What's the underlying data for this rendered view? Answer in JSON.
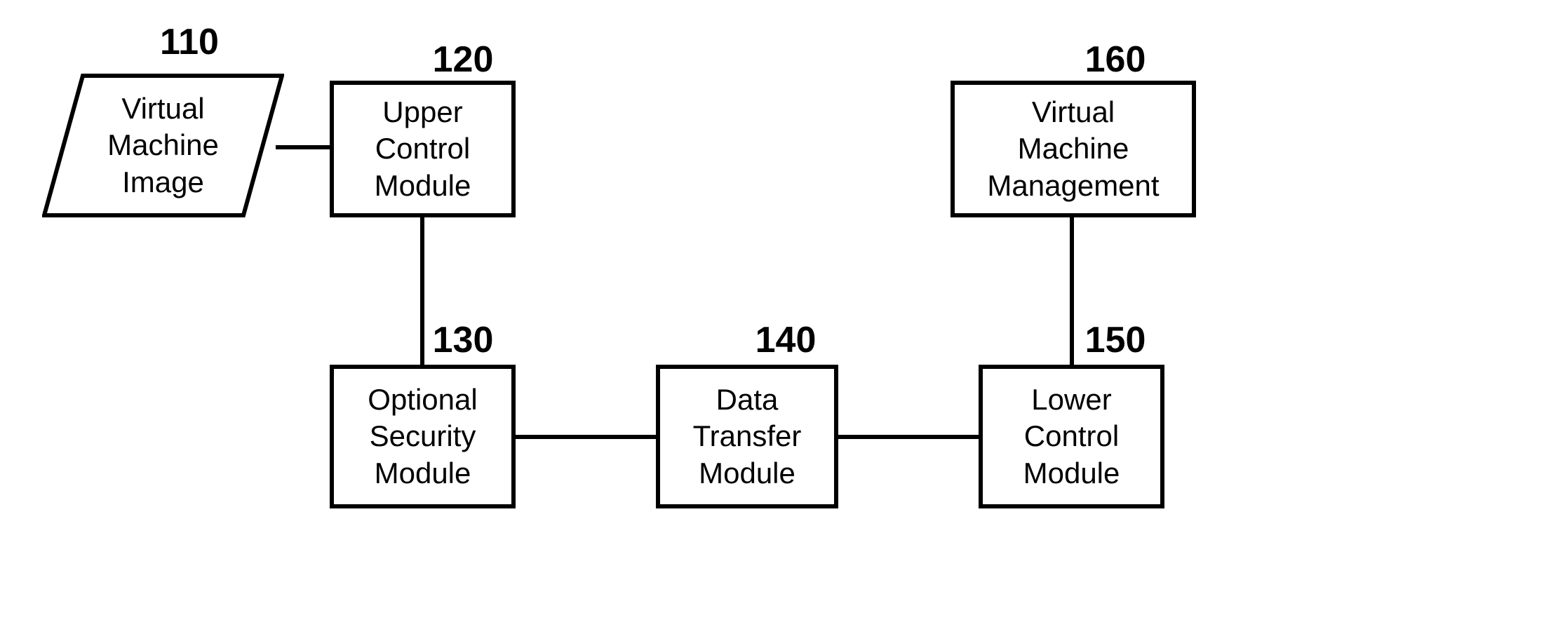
{
  "refs": {
    "n110": "110",
    "n120": "120",
    "n130": "130",
    "n140": "140",
    "n150": "150",
    "n160": "160"
  },
  "labels": {
    "n110": "Virtual\nMachine\nImage",
    "n120": "Upper\nControl\nModule",
    "n130": "Optional\nSecurity\nModule",
    "n140": "Data\nTransfer\nModule",
    "n150": "Lower\nControl\nModule",
    "n160": "Virtual\nMachine\nManagement"
  }
}
